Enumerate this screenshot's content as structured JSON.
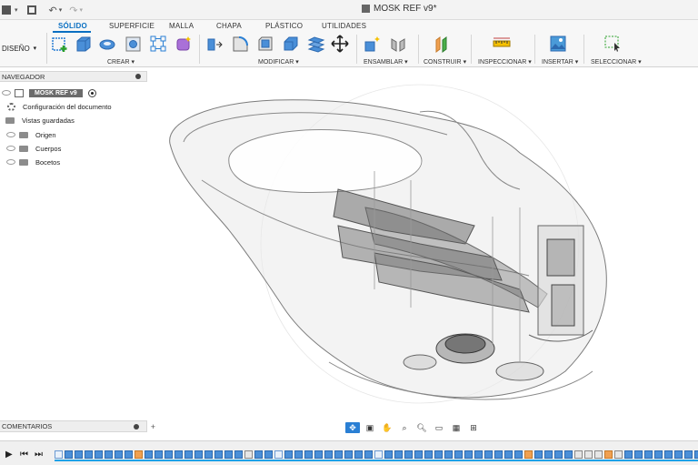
{
  "window": {
    "title": "MOSK REF v9*"
  },
  "ribbon": {
    "workspace_label": "DISEÑO",
    "tabs": [
      {
        "label": "SÓLIDO",
        "active": true
      },
      {
        "label": "SUPERFICIE",
        "active": false
      },
      {
        "label": "MALLA",
        "active": false
      },
      {
        "label": "CHAPA",
        "active": false
      },
      {
        "label": "PLÁSTICO",
        "active": false
      },
      {
        "label": "UTILIDADES",
        "active": false
      }
    ],
    "groups": {
      "crear": "CREAR",
      "modificar": "MODIFICAR",
      "ensamblar": "ENSAMBLAR",
      "construir": "CONSTRUIR",
      "inspeccionar": "INSPECCIONAR",
      "insertar": "INSERTAR",
      "seleccionar": "SELECCIONAR"
    }
  },
  "browser": {
    "header": "NAVEGADOR",
    "root": "MOSK REF v9",
    "items": [
      {
        "label": "Configuración del documento",
        "icon": "gear-icon"
      },
      {
        "label": "Vistas guardadas",
        "icon": "folder-icon"
      },
      {
        "label": "Origen",
        "icon": "folder-icon"
      },
      {
        "label": "Cuerpos",
        "icon": "folder-icon"
      },
      {
        "label": "Bocetos",
        "icon": "folder-icon"
      }
    ]
  },
  "comments": {
    "label": "COMENTARIOS"
  },
  "colors": {
    "accent": "#0a6fc2",
    "timeline_bar": "#1fa2e8"
  }
}
